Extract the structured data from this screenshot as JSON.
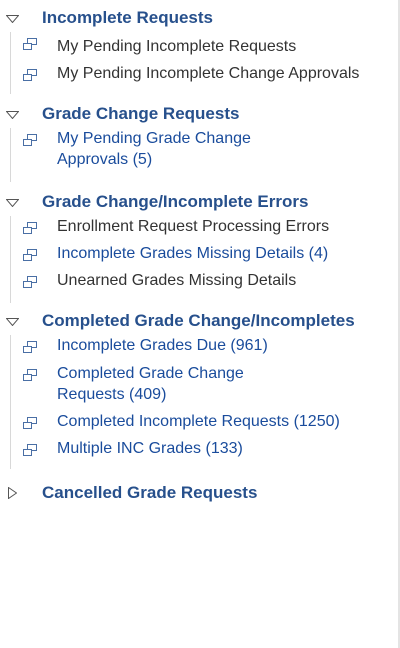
{
  "sections": [
    {
      "title": "Incomplete Requests",
      "expanded": true,
      "items": [
        {
          "label": "My Pending Incomplete Requests",
          "style": "dark"
        },
        {
          "label": "My Pending Incomplete Change Approvals",
          "style": "dark"
        }
      ]
    },
    {
      "title": "Grade Change Requests",
      "expanded": true,
      "items": [
        {
          "label": "My Pending Grade Change Approvals (5)",
          "style": "link"
        }
      ]
    },
    {
      "title": "Grade Change/Incomplete Errors",
      "expanded": true,
      "items": [
        {
          "label": "Enrollment Request Processing Errors",
          "style": "dark"
        },
        {
          "label": "Incomplete Grades Missing Details (4)",
          "style": "link"
        },
        {
          "label": "Unearned Grades Missing Details",
          "style": "dark"
        }
      ]
    },
    {
      "title": "Completed Grade Change/Incompletes",
      "expanded": true,
      "items": [
        {
          "label": "Incomplete Grades Due (961)",
          "style": "link"
        },
        {
          "label": "Completed Grade Change Requests (409)",
          "style": "link"
        },
        {
          "label": "Completed Incomplete Requests (1250)",
          "style": "link"
        },
        {
          "label": "Multiple INC Grades (133)",
          "style": "link"
        }
      ]
    },
    {
      "title": "Cancelled Grade Requests",
      "expanded": false,
      "items": []
    }
  ],
  "colors": {
    "header": "#27508c",
    "link": "#1a4c9c",
    "dark_text": "#333333",
    "icon": "#4a6fa5"
  }
}
